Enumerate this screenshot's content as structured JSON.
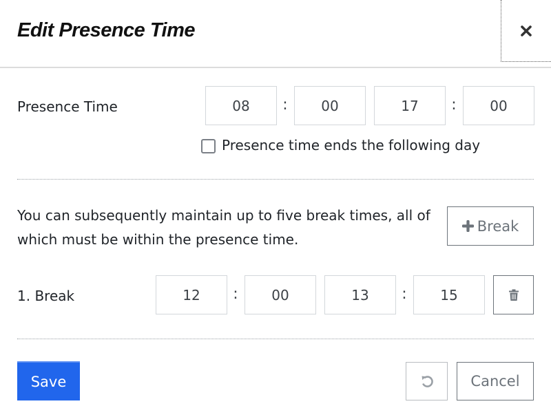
{
  "dialog": {
    "title": "Edit Presence Time",
    "close_icon": "close-icon"
  },
  "presence": {
    "label": "Presence Time",
    "start_hour": "08",
    "start_minute": "00",
    "end_hour": "17",
    "end_minute": "00",
    "separator": ":",
    "following_day_label": "Presence time ends the following day",
    "following_day_checked": false
  },
  "breaks_info": {
    "text": "You can subsequently maintain up to five break times, all of which must be within the presence time.",
    "add_break_label": "Break",
    "add_break_icon": "plus-icon"
  },
  "breaks": [
    {
      "label": "1. Break",
      "start_hour": "12",
      "start_minute": "00",
      "end_hour": "13",
      "end_minute": "15",
      "delete_icon": "trash-icon"
    }
  ],
  "footer": {
    "save_label": "Save",
    "reset_icon": "undo-icon",
    "cancel_label": "Cancel"
  },
  "colors": {
    "primary": "#2166ec",
    "border": "#d3d7db",
    "secondary_text": "#6c737a"
  }
}
